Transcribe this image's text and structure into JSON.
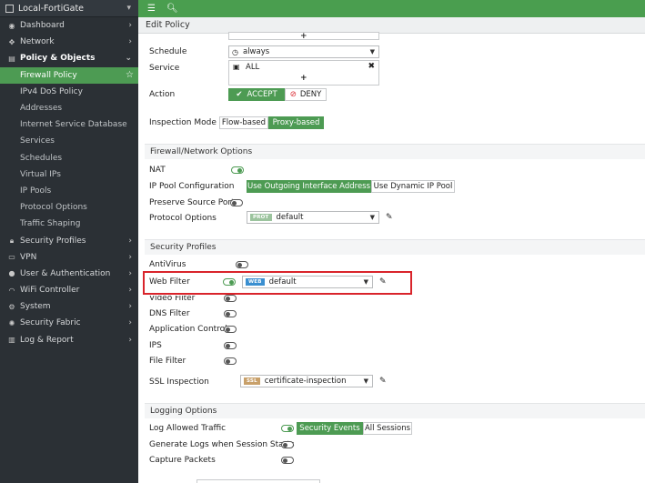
{
  "sidebar": {
    "device": "Local-FortiGate",
    "items": [
      {
        "label": "Dashboard",
        "icon": "dashboard-icon"
      },
      {
        "label": "Network",
        "icon": "network-icon"
      },
      {
        "label": "Policy & Objects",
        "icon": "policy-icon"
      },
      {
        "label": "Firewall Policy"
      },
      {
        "label": "IPv4 DoS Policy"
      },
      {
        "label": "Addresses"
      },
      {
        "label": "Internet Service Database"
      },
      {
        "label": "Services"
      },
      {
        "label": "Schedules"
      },
      {
        "label": "Virtual IPs"
      },
      {
        "label": "IP Pools"
      },
      {
        "label": "Protocol Options"
      },
      {
        "label": "Traffic Shaping"
      },
      {
        "label": "Security Profiles",
        "icon": "lock-icon"
      },
      {
        "label": "VPN",
        "icon": "vpn-icon"
      },
      {
        "label": "User & Authentication",
        "icon": "user-icon"
      },
      {
        "label": "WiFi Controller",
        "icon": "wifi-icon"
      },
      {
        "label": "System",
        "icon": "gear-icon"
      },
      {
        "label": "Security Fabric",
        "icon": "fabric-icon"
      },
      {
        "label": "Log & Report",
        "icon": "report-icon"
      }
    ]
  },
  "header": {
    "title": "Edit Policy"
  },
  "form": {
    "schedule_label": "Schedule",
    "schedule_value": "always",
    "service_label": "Service",
    "service_value": "ALL",
    "action_label": "Action",
    "accept": "ACCEPT",
    "deny": "DENY",
    "inspection_label": "Inspection Mode",
    "flow": "Flow-based",
    "proxy": "Proxy-based"
  },
  "fw": {
    "title": "Firewall/Network Options",
    "nat": "NAT",
    "ippool_label": "IP Pool Configuration",
    "ippool_outgoing": "Use Outgoing Interface Address",
    "ippool_dynamic": "Use Dynamic IP Pool",
    "preserve": "Preserve Source Port",
    "protocol_label": "Protocol Options",
    "protocol_tag": "PROT",
    "protocol_value": "default"
  },
  "sp": {
    "title": "Security Profiles",
    "antivirus": "AntiVirus",
    "webfilter": "Web Filter",
    "webfilter_tag": "WEB",
    "webfilter_value": "default",
    "video": "Video Filter",
    "dns": "DNS Filter",
    "appctrl": "Application Control",
    "ips": "IPS",
    "file": "File Filter",
    "ssl_label": "SSL Inspection",
    "ssl_tag": "SSL",
    "ssl_value": "certificate-inspection"
  },
  "log": {
    "title": "Logging Options",
    "allowed": "Log Allowed Traffic",
    "sec_events": "Security Events",
    "all_sessions": "All Sessions",
    "gen_logs": "Generate Logs when Session Starts",
    "capture": "Capture Packets"
  },
  "colors": {
    "accent": "#4d9b53",
    "highlight": "#d9242b",
    "sidebar_bg": "#2b3035"
  }
}
